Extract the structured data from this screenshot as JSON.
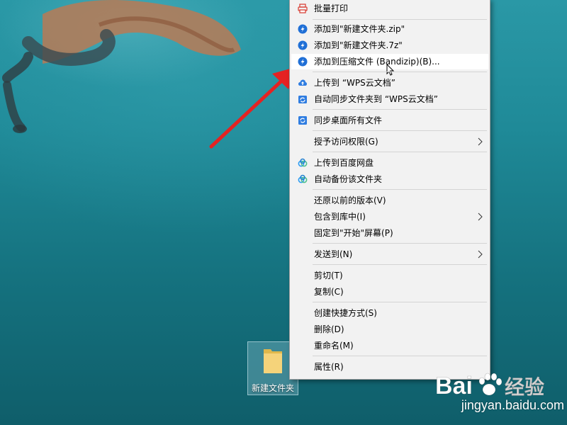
{
  "context_menu": {
    "items": [
      {
        "label": "批量打印",
        "icon": "printer-icon"
      },
      {
        "label": "添加到\"新建文件夹.zip\"",
        "icon": "bandizip-icon"
      },
      {
        "label": "添加到\"新建文件夹.7z\"",
        "icon": "bandizip-icon"
      },
      {
        "label": "添加到压缩文件 (Bandizip)(B)...",
        "icon": "bandizip-icon",
        "highlighted": true
      },
      {
        "label": "上传到 “WPS云文档”",
        "icon": "cloud-upload-icon"
      },
      {
        "label": "自动同步文件夹到 “WPS云文档”",
        "icon": "sync-folder-icon"
      },
      {
        "label": "同步桌面所有文件",
        "icon": "sync-desktop-icon"
      },
      {
        "label": "授予访问权限(G)",
        "submenu": true
      },
      {
        "label": "上传到百度网盘",
        "icon": "baidu-netdisk-icon"
      },
      {
        "label": "自动备份该文件夹",
        "icon": "baidu-netdisk-icon"
      },
      {
        "label": "还原以前的版本(V)"
      },
      {
        "label": "包含到库中(I)",
        "submenu": true
      },
      {
        "label": "固定到\"开始\"屏幕(P)"
      },
      {
        "label": "发送到(N)",
        "submenu": true
      },
      {
        "label": "剪切(T)"
      },
      {
        "label": "复制(C)"
      },
      {
        "label": "创建快捷方式(S)"
      },
      {
        "label": "删除(D)"
      },
      {
        "label": "重命名(M)"
      },
      {
        "label": "属性(R)"
      }
    ]
  },
  "desktop": {
    "folder_label": "新建文件夹"
  },
  "watermark": {
    "logo_text": "Bai 经验",
    "url": "jingyan.baidu.com"
  },
  "colors": {
    "accent_arrow": "#e52222",
    "bandizip_blue": "#1f6fd6",
    "menu_bg": "#f2f2f2",
    "highlight": "#ffffff"
  }
}
